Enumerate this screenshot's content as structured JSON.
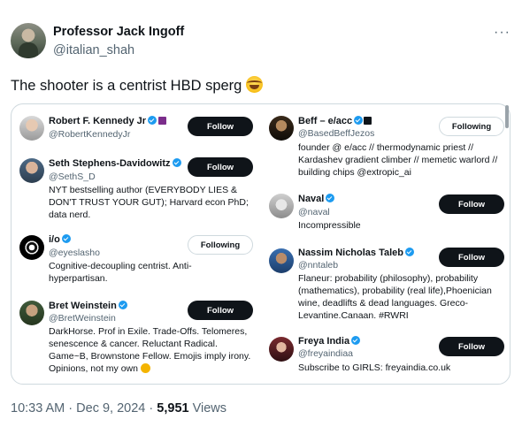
{
  "tweet": {
    "author_name": "Professor Jack Ingoff",
    "author_handle": "@italian_shah",
    "more_label": "···",
    "text": "The shooter is a centrist HBD sperg",
    "time": "10:33 AM",
    "sep1": "·",
    "date": "Dec 9, 2024",
    "sep2": "·",
    "views_count": "5,951",
    "views_label": "Views"
  },
  "embed": {
    "left_column": [
      {
        "name": "Robert F. Kennedy Jr",
        "handle": "@RobertKennedyJr",
        "button": "Follow",
        "bio": []
      },
      {
        "name": "Seth Stephens-Davidowitz",
        "handle": "@SethS_D",
        "button": "Follow",
        "bio": [
          "NYT bestselling author (EVERYBODY LIES &",
          "DON'T TRUST YOUR GUT); Harvard econ PhD;",
          "data nerd."
        ]
      },
      {
        "name": "i/o",
        "handle": "@eyeslasho",
        "button": "Following",
        "bio": [
          "Cognitive-decoupling centrist. Anti-",
          "hyperpartisan."
        ]
      },
      {
        "name": "Bret Weinstein",
        "handle": "@BretWeinstein",
        "button": "Follow",
        "bio": [
          "DarkHorse. Prof in Exile. Trade-Offs. Telomeres,",
          "senescence & cancer. Reluctant Radical.",
          "Game~B, Brownstone Fellow. Emojis imply irony.",
          "Opinions, not my own"
        ]
      }
    ],
    "right_column": [
      {
        "name": "Beff – e/acc",
        "handle": "@BasedBeffJezos",
        "button": "Following",
        "bio": [
          "founder @ e/acc // thermodynamic priest //",
          "Kardashev gradient climber // memetic warlord //",
          "building chips @extropic_ai"
        ]
      },
      {
        "name": "Naval",
        "handle": "@naval",
        "button": "Follow",
        "bio": [
          "Incompressible"
        ]
      },
      {
        "name": "Nassim Nicholas Taleb",
        "handle": "@nntaleb",
        "button": "Follow",
        "bio": [
          "Flaneur: probability (philosophy), probability",
          "(mathematics), probability (real life),Phoenician",
          "wine, deadlifts & dead languages. Greco-",
          "Levantine.Canaan. #RWRI"
        ]
      },
      {
        "name": "Freya India",
        "handle": "@freyaindiaa",
        "button": "Follow",
        "bio": [
          "Subscribe to GIRLS: freyaindia.co.uk"
        ]
      }
    ]
  },
  "colors": {
    "text_primary": "#0f1419",
    "text_secondary": "#536471",
    "verified_blue": "#1d9bf0",
    "border": "#cfd9de",
    "follow_bg": "#0f1419"
  },
  "icons": [
    "more-horizontal-icon",
    "joy-emoji-icon",
    "verified-badge-icon",
    "thinking-emoji-icon"
  ]
}
